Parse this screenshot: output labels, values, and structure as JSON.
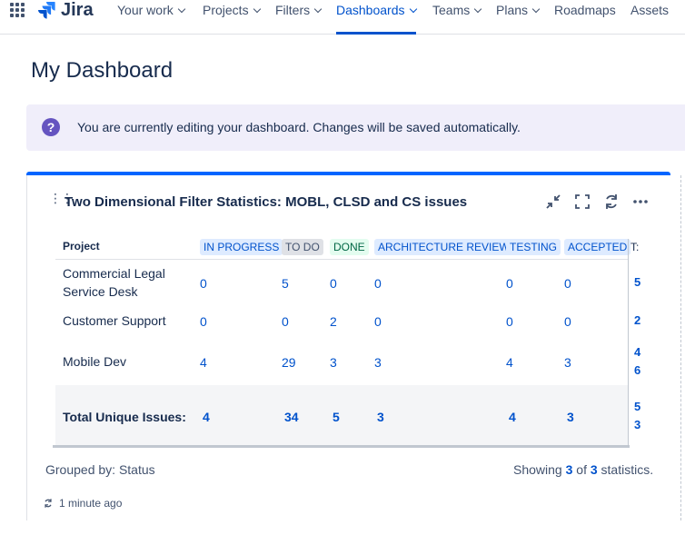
{
  "nav": {
    "logo": "Jira",
    "items": [
      {
        "label": "Your work"
      },
      {
        "label": "Projects"
      },
      {
        "label": "Filters"
      },
      {
        "label": "Dashboards"
      },
      {
        "label": "Teams"
      },
      {
        "label": "Plans"
      },
      {
        "label": "Roadmaps"
      },
      {
        "label": "Assets"
      }
    ],
    "active": "Dashboards",
    "accent_color": "#0052cc"
  },
  "page": {
    "title": "My Dashboard"
  },
  "banner": {
    "icon": "question-icon",
    "text": "You are currently editing your dashboard. Changes will be saved automatically.",
    "icon_color": "#6554c0"
  },
  "gadget": {
    "title": "Two Dimensional Filter Statistics: MOBL, CLSD and CS issues",
    "icons": [
      "collapse-icon",
      "fullscreen-icon",
      "refresh-icon",
      "more-icon"
    ],
    "columns": {
      "project": "Project",
      "statuses": [
        "IN PROGRESS",
        "TO DO",
        "DONE",
        "ARCHITECTURE REVIEW",
        "TESTING",
        "ACCEPTED"
      ],
      "truncated": "T:"
    },
    "rows": [
      {
        "project": "Commercial Legal Service Desk",
        "values": [
          "0",
          "5",
          "0",
          "0",
          "0",
          "0"
        ],
        "total": "5"
      },
      {
        "project": "Customer Support",
        "values": [
          "0",
          "0",
          "2",
          "0",
          "0",
          "0"
        ],
        "total": "2"
      },
      {
        "project": "Mobile Dev",
        "values": [
          "4",
          "29",
          "3",
          "3",
          "4",
          "3"
        ],
        "total": "4\n6"
      }
    ],
    "totals": {
      "label": "Total Unique Issues:",
      "values": [
        "4",
        "34",
        "5",
        "3",
        "4",
        "3"
      ],
      "total": "5\n3"
    },
    "footer": {
      "grouped": "Grouped by: Status",
      "showing_prefix": "Showing",
      "showing_count": "3",
      "showing_of": "of",
      "showing_total": "3",
      "showing_suffix": "statistics."
    },
    "updated": "1 minute ago"
  }
}
